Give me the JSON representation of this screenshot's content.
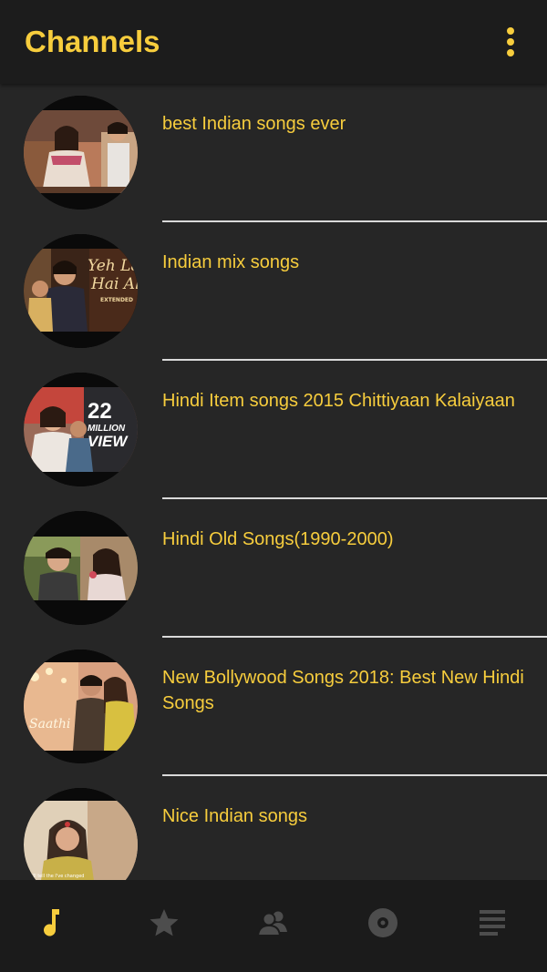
{
  "app_bar": {
    "title": "Channels",
    "menu_icon": "more-vert-icon"
  },
  "channels": [
    {
      "title": "best Indian songs ever"
    },
    {
      "title": "Indian mix songs"
    },
    {
      "title": "Hindi Item songs 2015 Chittiyaan Kalaiyaan"
    },
    {
      "title": "Hindi Old Songs(1990-2000)"
    },
    {
      "title": "New Bollywood Songs 2018: Best New Hindi Songs"
    },
    {
      "title": "Nice Indian songs"
    }
  ],
  "thumbnail_overlays": {
    "t2_line1": "Yeh Lad",
    "t2_line2": "Hai Alla",
    "t2_line3": "EXTENDED",
    "t3_number": "22",
    "t3_line1": "MILLION",
    "t3_line2": "VIEW",
    "t5_script": "Saathi",
    "t6_caption": "I'll tell the I've changed"
  },
  "bottom_nav": {
    "items": [
      {
        "name": "songs",
        "icon": "music-note-icon",
        "active": true
      },
      {
        "name": "favorites",
        "icon": "star-icon",
        "active": false
      },
      {
        "name": "artists",
        "icon": "people-icon",
        "active": false
      },
      {
        "name": "albums",
        "icon": "disc-icon",
        "active": false
      },
      {
        "name": "playlists",
        "icon": "list-icon",
        "active": false
      }
    ]
  },
  "colors": {
    "accent": "#f7cd3d",
    "background": "#262626",
    "app_bar": "#1c1c1c",
    "bottom_nav": "#1b1b1b",
    "inactive_icon": "#4d4d4d",
    "divider": "#d9d9d9"
  }
}
